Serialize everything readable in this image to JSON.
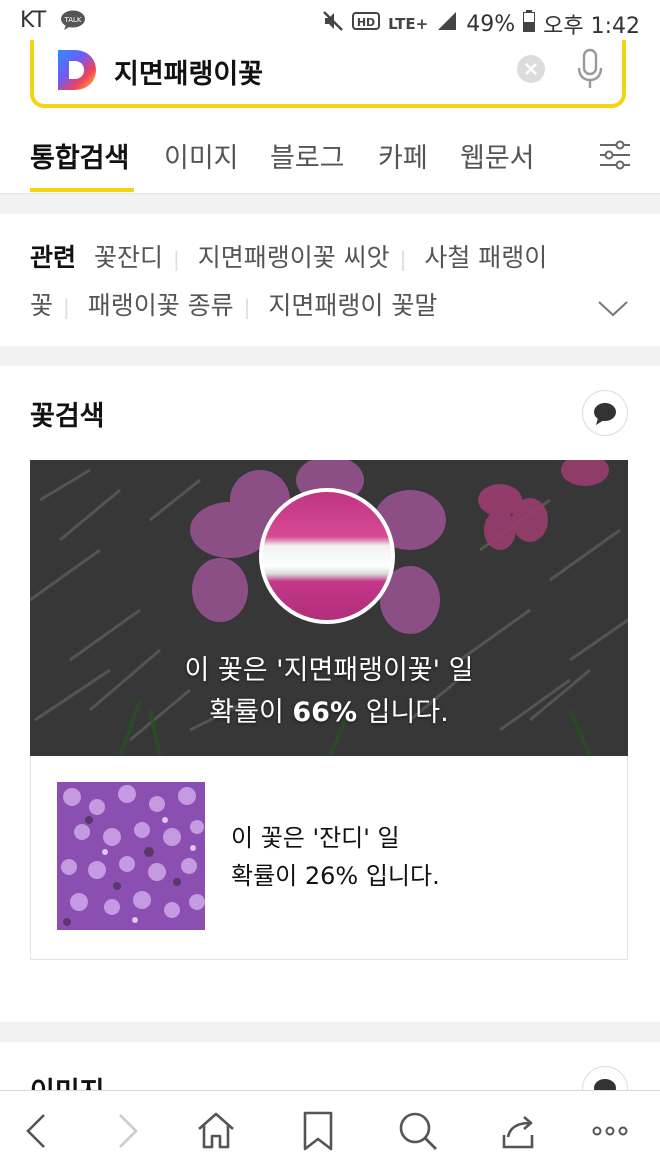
{
  "status_bar": {
    "carrier": "KT",
    "battery": "49%",
    "time": "오후 1:42",
    "lte_label": "LTE+",
    "hd_label": "HD",
    "icons": [
      "talk-icon",
      "mute-icon",
      "hd-icon",
      "lte-icon",
      "signal-icon",
      "battery-icon"
    ]
  },
  "search": {
    "query": "지면패랭이꽃",
    "brand_color": "#f7d40d"
  },
  "tabs": [
    {
      "label": "통합검색",
      "active": true
    },
    {
      "label": "이미지"
    },
    {
      "label": "블로그"
    },
    {
      "label": "카페"
    },
    {
      "label": "웹문서"
    }
  ],
  "related": {
    "label": "관련",
    "items": [
      "꽃잔디",
      "지면패랭이꽃 씨앗",
      "사철 패랭이",
      "꽃",
      "패랭이꽃 종류",
      "지면패랭이 꽃말"
    ]
  },
  "flower_search": {
    "title": "꽃검색",
    "top_result": {
      "line1": "이 꽃은 '지면패랭이꽃' 일",
      "line2_prefix": "확률이 ",
      "percent": "66%",
      "line2_suffix": " 입니다."
    },
    "second_result": {
      "line1": "이 꽃은 '잔디' 일",
      "line2": "확률이 26% 입니다."
    }
  },
  "images_section": {
    "title": "이미지"
  }
}
